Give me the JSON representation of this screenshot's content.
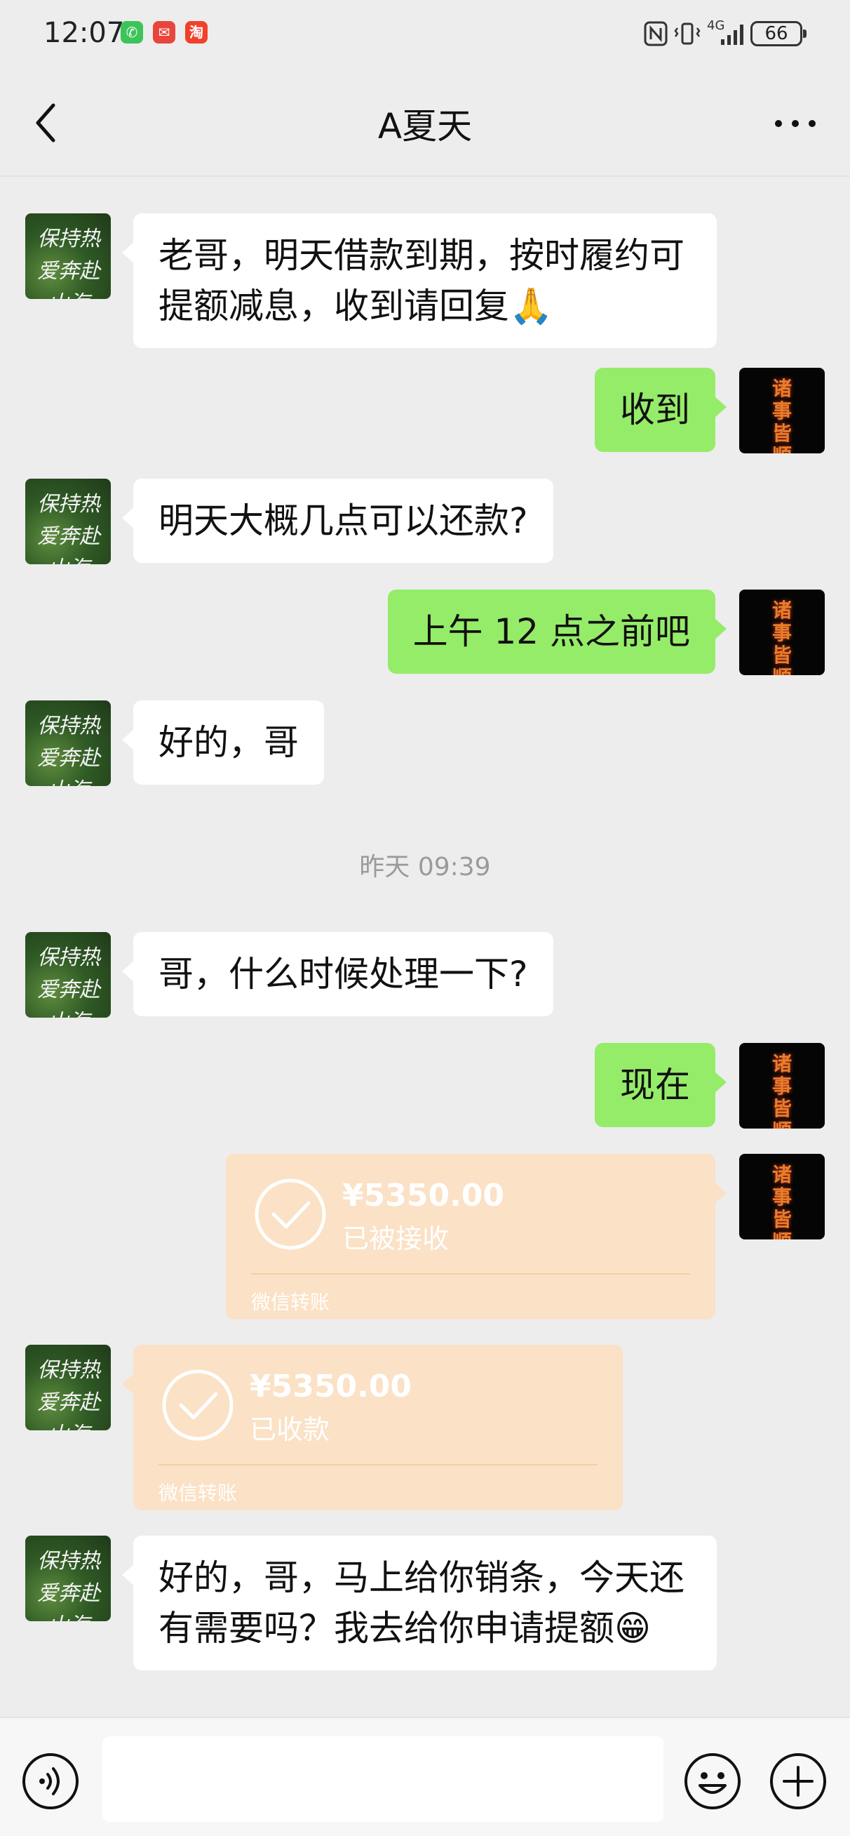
{
  "status_bar": {
    "time": "12:07",
    "battery": "66",
    "network": "4G"
  },
  "header": {
    "title": "A夏天"
  },
  "contact_avatar": {
    "text": "保持热爱奔赴山海"
  },
  "self_avatar": {
    "text": "诸事皆顺"
  },
  "messages": [
    {
      "from": "contact",
      "text": "老哥，明天借款到期，按时履约可提额减息，收到请回复🙏"
    },
    {
      "from": "self",
      "text": "收到"
    },
    {
      "from": "contact",
      "text": "明天大概几点可以还款?"
    },
    {
      "from": "self",
      "text": "上午 12 点之前吧"
    },
    {
      "from": "contact",
      "text": "好的，哥"
    },
    {
      "from": "contact",
      "text": "哥，什么时候处理一下?"
    },
    {
      "from": "self",
      "text": "现在"
    },
    {
      "from": "contact",
      "text": "好的，哥，马上给你销条，今天还有需要吗？我去给你申请提额😁"
    }
  ],
  "timestamp": "昨天 09:39",
  "transfers": {
    "sent": {
      "amount": "¥5350.00",
      "status": "已被接收",
      "label": "微信转账"
    },
    "received": {
      "amount": "¥5350.00",
      "status": "已收款",
      "label": "微信转账"
    }
  },
  "icons": {
    "back": "chevron-left-icon",
    "more": "more-dots-icon",
    "voice": "voice-icon",
    "emoji": "emoji-icon",
    "plus": "plus-icon"
  },
  "colors": {
    "background": "#ededed",
    "self_bubble": "#95ec69",
    "contact_bubble": "#ffffff",
    "transfer_card": "#fbe1c5"
  }
}
